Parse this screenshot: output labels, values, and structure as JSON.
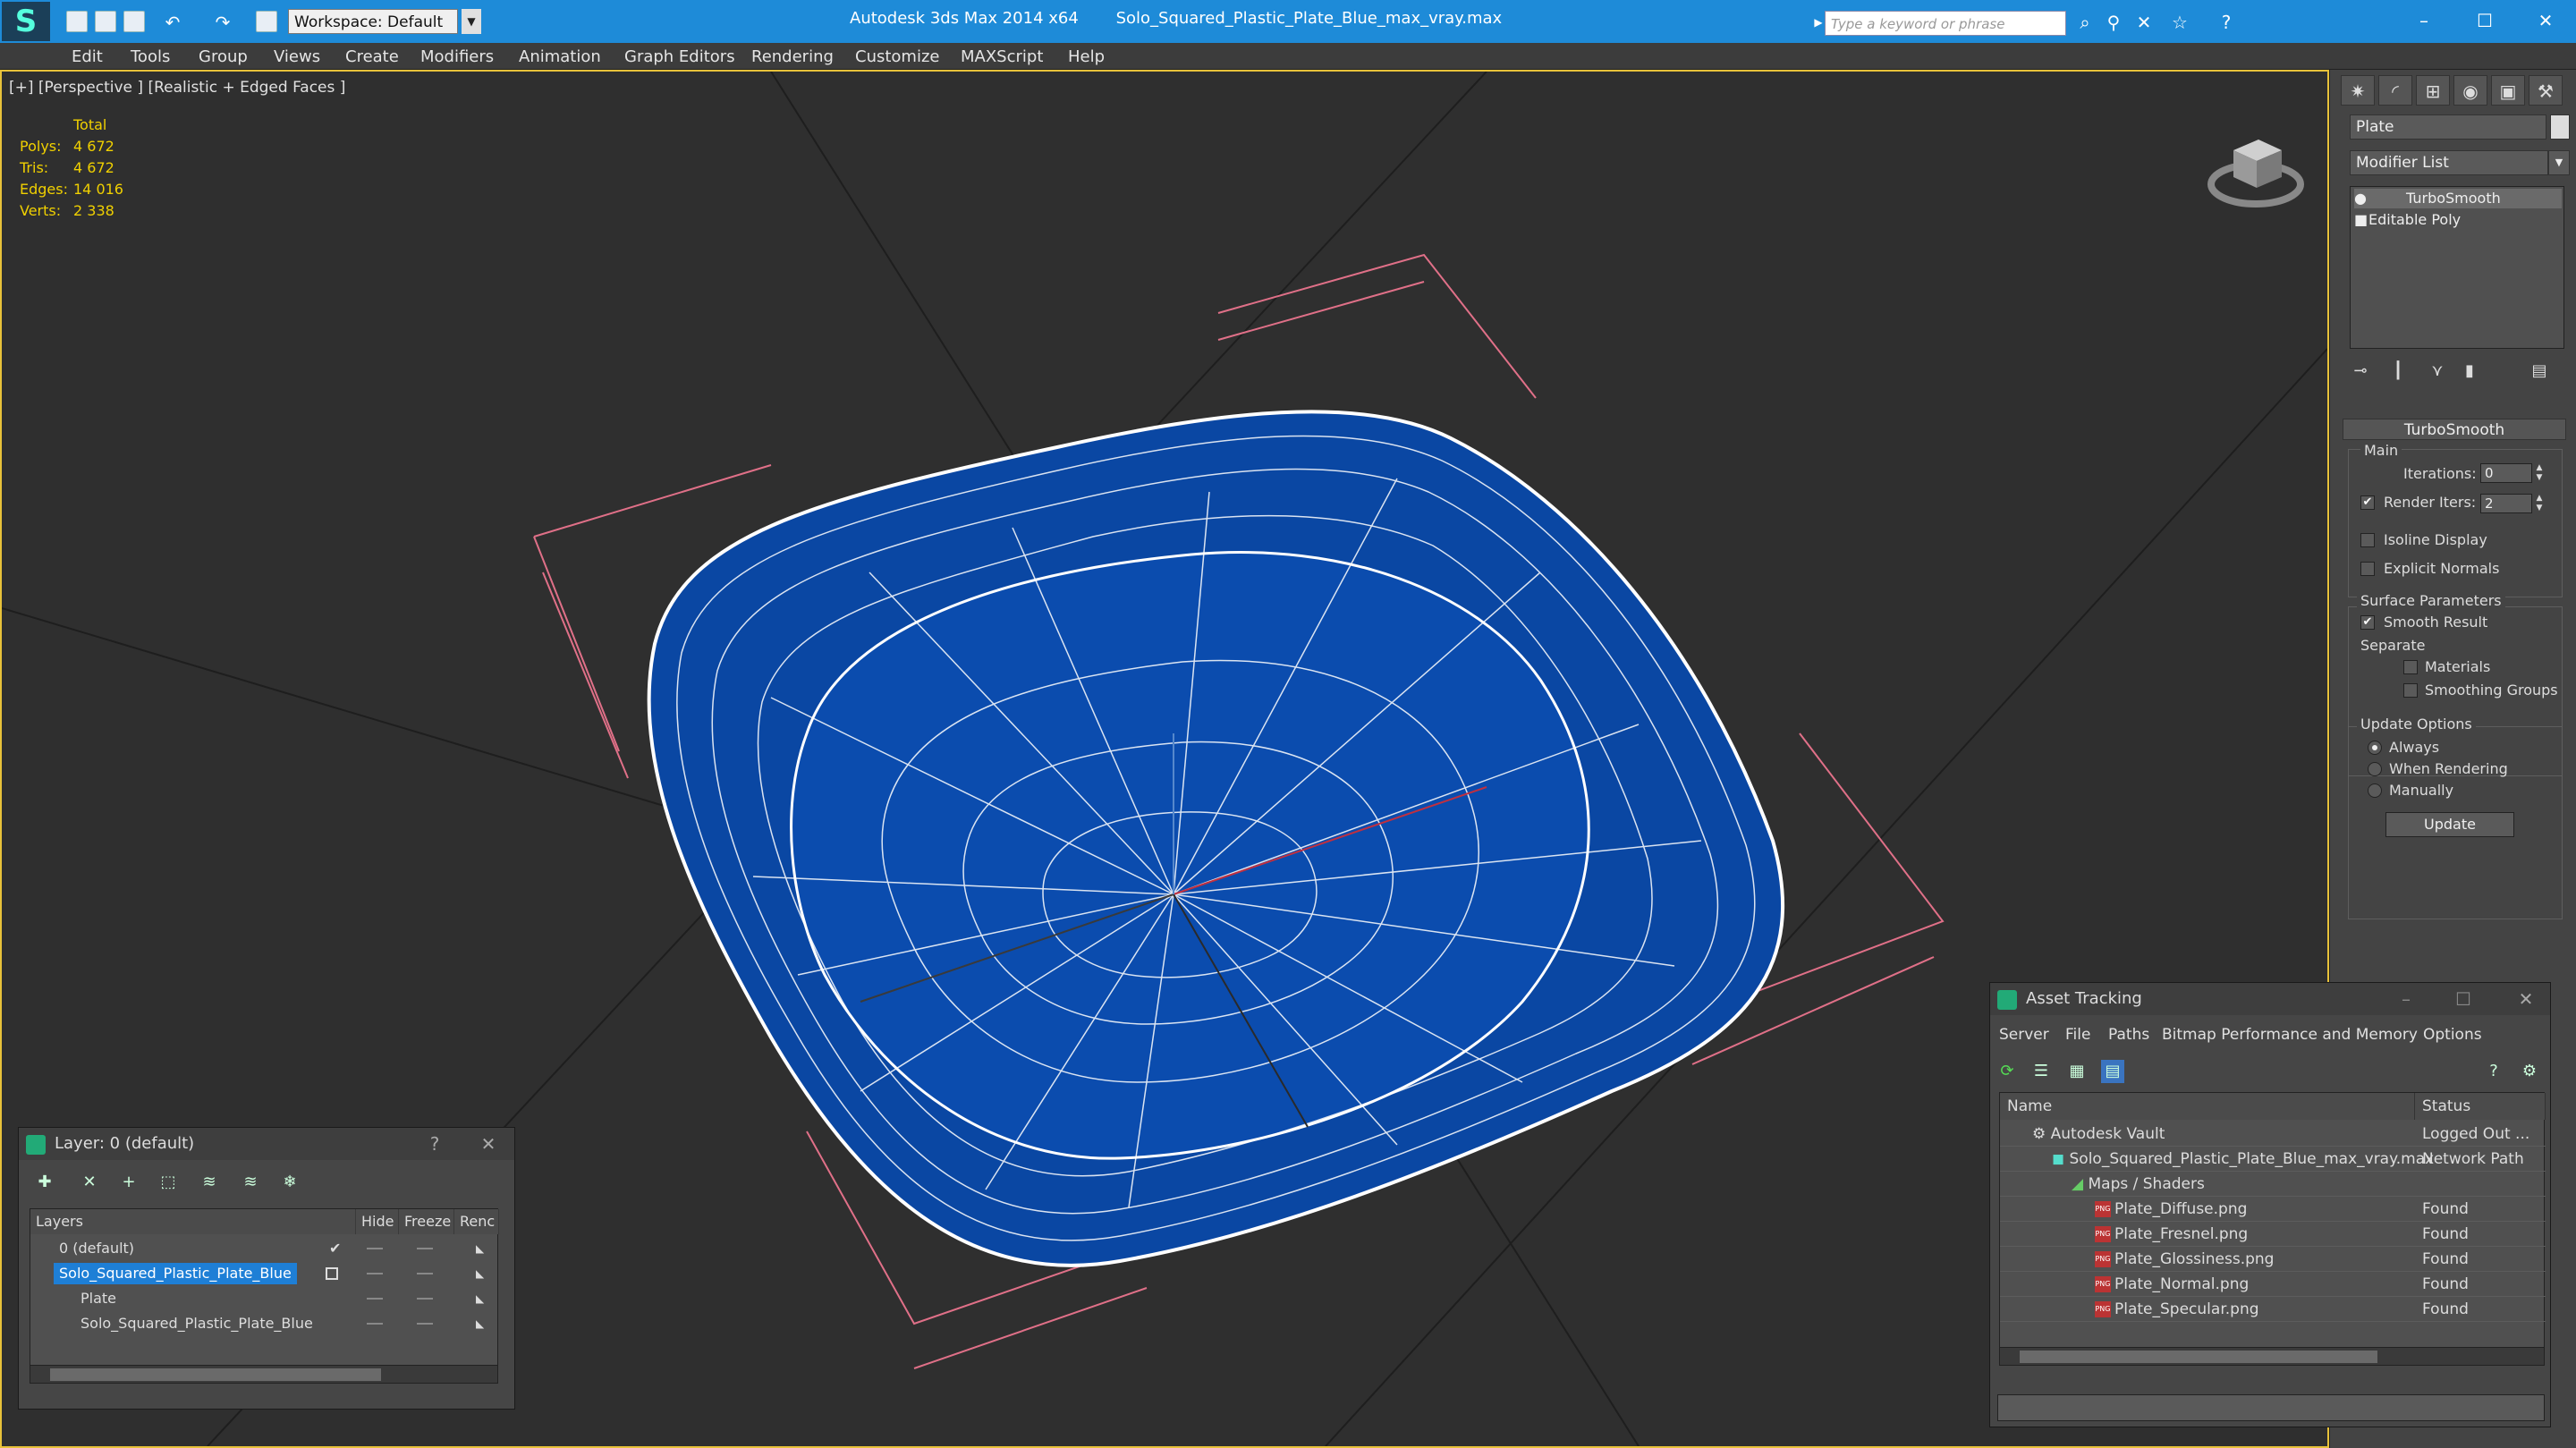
{
  "app": {
    "title": "Autodesk 3ds Max  2014 x64",
    "filename": "Solo_Squared_Plastic_Plate_Blue_max_vray.max",
    "workspace": "Workspace: Default",
    "search_placeholder": "Type a keyword or phrase"
  },
  "menu": [
    "Edit",
    "Tools",
    "Group",
    "Views",
    "Create",
    "Modifiers",
    "Animation",
    "Graph Editors",
    "Rendering",
    "Customize",
    "MAXScript",
    "Help"
  ],
  "viewport": {
    "label": "[+] [Perspective ] [Realistic + Edged Faces ]",
    "stats_header": "Total",
    "stats": [
      {
        "k": "Polys:",
        "v": "4 672"
      },
      {
        "k": "Tris:",
        "v": "4 672"
      },
      {
        "k": "Edges:",
        "v": "14 016"
      },
      {
        "k": "Verts:",
        "v": "2 338"
      }
    ],
    "mesh_color": "#0a47a3",
    "wire_color": "#ffffff",
    "bbox_color": "#e07088"
  },
  "command_panel": {
    "object_name": "Plate",
    "modifier_list": "Modifier List",
    "stack": [
      "TurboSmooth",
      "Editable Poly"
    ],
    "rollout_title": "TurboSmooth",
    "main_group": "Main",
    "iterations_label": "Iterations:",
    "iterations_value": "0",
    "render_iters_label": "Render Iters:",
    "render_iters_value": "2",
    "isoline": "Isoline Display",
    "explicit_normals": "Explicit Normals",
    "surface_group": "Surface Parameters",
    "smooth_result": "Smooth Result",
    "separate": "Separate",
    "materials": "Materials",
    "smoothing_groups": "Smoothing Groups",
    "update_group": "Update Options",
    "always": "Always",
    "when_rendering": "When Rendering",
    "manually": "Manually",
    "update_button": "Update"
  },
  "layer_dialog": {
    "title": "Layer: 0 (default)",
    "help": "?",
    "close": "✕",
    "columns": [
      "Layers",
      "Hide",
      "Freeze",
      "Renc"
    ],
    "rows": [
      {
        "name": "0 (default)"
      },
      {
        "name": "Solo_Squared_Plastic_Plate_Blue"
      },
      {
        "name": "Plate"
      },
      {
        "name": "Solo_Squared_Plastic_Plate_Blue"
      }
    ]
  },
  "asset_dialog": {
    "title": "Asset Tracking",
    "menu": [
      "Server",
      "File",
      "Paths",
      "Bitmap Performance and Memory",
      "Options"
    ],
    "columns": [
      "Name",
      "Status"
    ],
    "rows": [
      {
        "name": "Autodesk Vault",
        "status": "Logged Out ..."
      },
      {
        "name": "Solo_Squared_Plastic_Plate_Blue_max_vray.max",
        "status": "Network Path"
      },
      {
        "name": "Maps / Shaders",
        "status": ""
      },
      {
        "name": "Plate_Diffuse.png",
        "status": "Found"
      },
      {
        "name": "Plate_Fresnel.png",
        "status": "Found"
      },
      {
        "name": "Plate_Glossiness.png",
        "status": "Found"
      },
      {
        "name": "Plate_Normal.png",
        "status": "Found"
      },
      {
        "name": "Plate_Specular.png",
        "status": "Found"
      }
    ]
  }
}
